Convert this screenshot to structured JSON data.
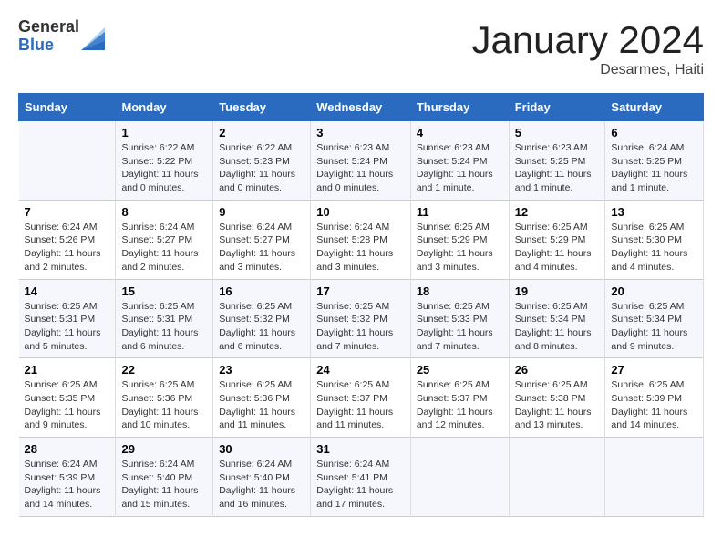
{
  "header": {
    "logo_general": "General",
    "logo_blue": "Blue",
    "month_title": "January 2024",
    "location": "Desarmes, Haiti"
  },
  "weekdays": [
    "Sunday",
    "Monday",
    "Tuesday",
    "Wednesday",
    "Thursday",
    "Friday",
    "Saturday"
  ],
  "weeks": [
    [
      {
        "day": "",
        "sunrise": "",
        "sunset": "",
        "daylight": ""
      },
      {
        "day": "1",
        "sunrise": "Sunrise: 6:22 AM",
        "sunset": "Sunset: 5:22 PM",
        "daylight": "Daylight: 11 hours and 0 minutes."
      },
      {
        "day": "2",
        "sunrise": "Sunrise: 6:22 AM",
        "sunset": "Sunset: 5:23 PM",
        "daylight": "Daylight: 11 hours and 0 minutes."
      },
      {
        "day": "3",
        "sunrise": "Sunrise: 6:23 AM",
        "sunset": "Sunset: 5:24 PM",
        "daylight": "Daylight: 11 hours and 0 minutes."
      },
      {
        "day": "4",
        "sunrise": "Sunrise: 6:23 AM",
        "sunset": "Sunset: 5:24 PM",
        "daylight": "Daylight: 11 hours and 1 minute."
      },
      {
        "day": "5",
        "sunrise": "Sunrise: 6:23 AM",
        "sunset": "Sunset: 5:25 PM",
        "daylight": "Daylight: 11 hours and 1 minute."
      },
      {
        "day": "6",
        "sunrise": "Sunrise: 6:24 AM",
        "sunset": "Sunset: 5:25 PM",
        "daylight": "Daylight: 11 hours and 1 minute."
      }
    ],
    [
      {
        "day": "7",
        "sunrise": "Sunrise: 6:24 AM",
        "sunset": "Sunset: 5:26 PM",
        "daylight": "Daylight: 11 hours and 2 minutes."
      },
      {
        "day": "8",
        "sunrise": "Sunrise: 6:24 AM",
        "sunset": "Sunset: 5:27 PM",
        "daylight": "Daylight: 11 hours and 2 minutes."
      },
      {
        "day": "9",
        "sunrise": "Sunrise: 6:24 AM",
        "sunset": "Sunset: 5:27 PM",
        "daylight": "Daylight: 11 hours and 3 minutes."
      },
      {
        "day": "10",
        "sunrise": "Sunrise: 6:24 AM",
        "sunset": "Sunset: 5:28 PM",
        "daylight": "Daylight: 11 hours and 3 minutes."
      },
      {
        "day": "11",
        "sunrise": "Sunrise: 6:25 AM",
        "sunset": "Sunset: 5:29 PM",
        "daylight": "Daylight: 11 hours and 3 minutes."
      },
      {
        "day": "12",
        "sunrise": "Sunrise: 6:25 AM",
        "sunset": "Sunset: 5:29 PM",
        "daylight": "Daylight: 11 hours and 4 minutes."
      },
      {
        "day": "13",
        "sunrise": "Sunrise: 6:25 AM",
        "sunset": "Sunset: 5:30 PM",
        "daylight": "Daylight: 11 hours and 4 minutes."
      }
    ],
    [
      {
        "day": "14",
        "sunrise": "Sunrise: 6:25 AM",
        "sunset": "Sunset: 5:31 PM",
        "daylight": "Daylight: 11 hours and 5 minutes."
      },
      {
        "day": "15",
        "sunrise": "Sunrise: 6:25 AM",
        "sunset": "Sunset: 5:31 PM",
        "daylight": "Daylight: 11 hours and 6 minutes."
      },
      {
        "day": "16",
        "sunrise": "Sunrise: 6:25 AM",
        "sunset": "Sunset: 5:32 PM",
        "daylight": "Daylight: 11 hours and 6 minutes."
      },
      {
        "day": "17",
        "sunrise": "Sunrise: 6:25 AM",
        "sunset": "Sunset: 5:32 PM",
        "daylight": "Daylight: 11 hours and 7 minutes."
      },
      {
        "day": "18",
        "sunrise": "Sunrise: 6:25 AM",
        "sunset": "Sunset: 5:33 PM",
        "daylight": "Daylight: 11 hours and 7 minutes."
      },
      {
        "day": "19",
        "sunrise": "Sunrise: 6:25 AM",
        "sunset": "Sunset: 5:34 PM",
        "daylight": "Daylight: 11 hours and 8 minutes."
      },
      {
        "day": "20",
        "sunrise": "Sunrise: 6:25 AM",
        "sunset": "Sunset: 5:34 PM",
        "daylight": "Daylight: 11 hours and 9 minutes."
      }
    ],
    [
      {
        "day": "21",
        "sunrise": "Sunrise: 6:25 AM",
        "sunset": "Sunset: 5:35 PM",
        "daylight": "Daylight: 11 hours and 9 minutes."
      },
      {
        "day": "22",
        "sunrise": "Sunrise: 6:25 AM",
        "sunset": "Sunset: 5:36 PM",
        "daylight": "Daylight: 11 hours and 10 minutes."
      },
      {
        "day": "23",
        "sunrise": "Sunrise: 6:25 AM",
        "sunset": "Sunset: 5:36 PM",
        "daylight": "Daylight: 11 hours and 11 minutes."
      },
      {
        "day": "24",
        "sunrise": "Sunrise: 6:25 AM",
        "sunset": "Sunset: 5:37 PM",
        "daylight": "Daylight: 11 hours and 11 minutes."
      },
      {
        "day": "25",
        "sunrise": "Sunrise: 6:25 AM",
        "sunset": "Sunset: 5:37 PM",
        "daylight": "Daylight: 11 hours and 12 minutes."
      },
      {
        "day": "26",
        "sunrise": "Sunrise: 6:25 AM",
        "sunset": "Sunset: 5:38 PM",
        "daylight": "Daylight: 11 hours and 13 minutes."
      },
      {
        "day": "27",
        "sunrise": "Sunrise: 6:25 AM",
        "sunset": "Sunset: 5:39 PM",
        "daylight": "Daylight: 11 hours and 14 minutes."
      }
    ],
    [
      {
        "day": "28",
        "sunrise": "Sunrise: 6:24 AM",
        "sunset": "Sunset: 5:39 PM",
        "daylight": "Daylight: 11 hours and 14 minutes."
      },
      {
        "day": "29",
        "sunrise": "Sunrise: 6:24 AM",
        "sunset": "Sunset: 5:40 PM",
        "daylight": "Daylight: 11 hours and 15 minutes."
      },
      {
        "day": "30",
        "sunrise": "Sunrise: 6:24 AM",
        "sunset": "Sunset: 5:40 PM",
        "daylight": "Daylight: 11 hours and 16 minutes."
      },
      {
        "day": "31",
        "sunrise": "Sunrise: 6:24 AM",
        "sunset": "Sunset: 5:41 PM",
        "daylight": "Daylight: 11 hours and 17 minutes."
      },
      {
        "day": "",
        "sunrise": "",
        "sunset": "",
        "daylight": ""
      },
      {
        "day": "",
        "sunrise": "",
        "sunset": "",
        "daylight": ""
      },
      {
        "day": "",
        "sunrise": "",
        "sunset": "",
        "daylight": ""
      }
    ]
  ]
}
